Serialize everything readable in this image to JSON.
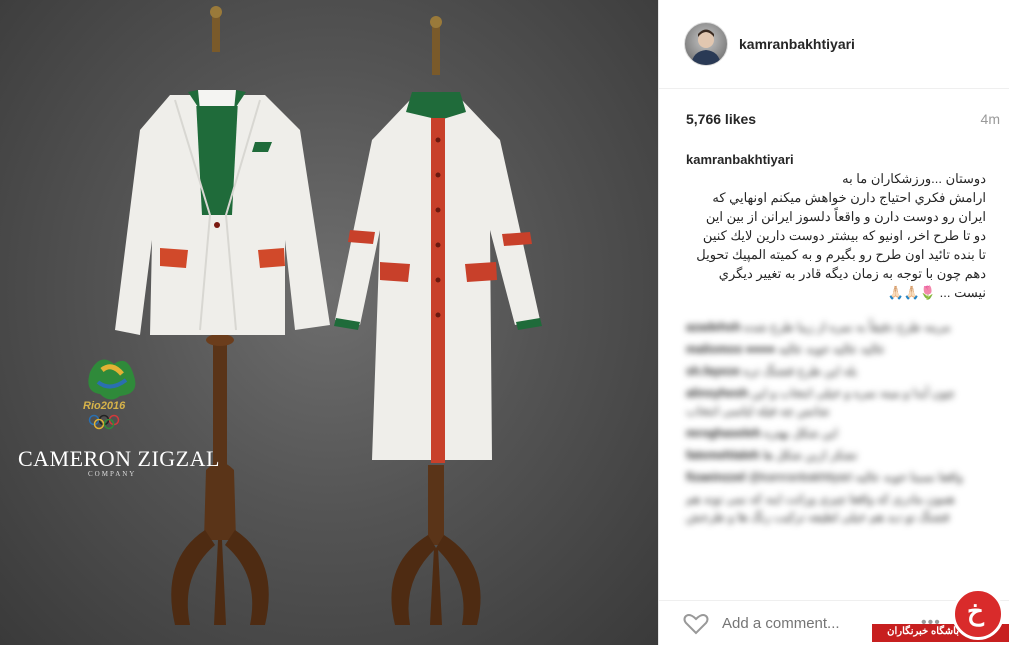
{
  "photo": {
    "brand_name": "CAMERON ZIGZAL",
    "brand_sub": "COMPANY",
    "rio_logo_text": "Rio2016"
  },
  "post": {
    "username": "kamranbakhtiyari",
    "likes": "5,766 likes",
    "time": "4m",
    "caption_user": "kamranbakhtiyari",
    "caption_text": "دوستان ...ورزشكاران ما به\nارامش فكري احتياج دارن خواهش ميكنم اونهايي كه\nايران رو دوست دارن و واقعاً دلسوز ايرانن از بين اين\nدو تا طرح اخر، اونيو كه بيشتر دوست دارين لايك كنين\nتا بنده تائيد اون طرح رو بگيرم و به كميته المپيك تحويل\nدهم چون با توجه به زمان ديگه قادر به تغيير ديگري\nنيست ... 🌷🙏🏻🙏🏻",
    "comments": [
      {
        "user": "azadehsh",
        "text": "مرینه طرح دقیقاً به نمره از زیبا طرح شده"
      },
      {
        "user": "maliomoo",
        "text": "●●●● عالیه عالیه خوبه عالیه"
      },
      {
        "user": "sh.fayeze",
        "text": "بله این طرح قشنگ تره"
      },
      {
        "user": "alinsyhesh",
        "text": "چون آیدا و مینه نمره و خیلی انتخاب و این شانس چه فیله لباسی انتخاب"
      },
      {
        "user": "mroghaseleh",
        "text": "این شکل بهتره"
      },
      {
        "user": "fatemehlaleh",
        "text": "تشکر ازبن شکل ها"
      },
      {
        "user": "fizaeinzzel",
        "text": "@kamranbakhtiyari واقعا نسبتا خوبه عالیه",
        "link": "@kamranbakhtiyari"
      },
      {
        "user": "",
        "text": "همون مادری که واقعا چیزی وراثت اینه که نمی تونه هم قشنگ تو دید هم خیلی لطیفه ترکیب رنگ ها و طرحش"
      }
    ],
    "add_comment_placeholder": "Add a comment...",
    "more_label": "•••"
  },
  "watermark": {
    "label": "باشگاه خبرنگاران",
    "glyph": "خ"
  },
  "colors": {
    "accent_red": "#c71f1f",
    "jacket_green": "#1f6b3a",
    "jacket_orange": "#d1492a"
  }
}
